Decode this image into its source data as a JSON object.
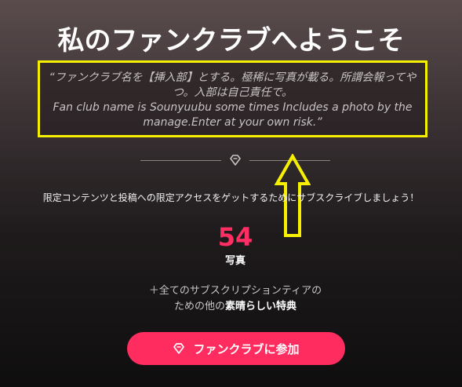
{
  "header": {
    "title": "私のファンクラブへようこそ"
  },
  "description": {
    "line1": "“ファンクラブ名を【挿入部】とする。極稀に写真が載る。所謂会報ってや",
    "line2": "つ。入部は自己責任で。",
    "line3": "Fan club name is Sounyuubu some times Includes a photo by the",
    "line4": "manage.Enter at your own risk.”"
  },
  "divider_icon": "diamond-icon",
  "subscribe_prompt": "限定コンテンツと投稿への限定アクセスをゲットするためにサブスクライブしましょう！",
  "stats": {
    "count": "54",
    "label": "写真"
  },
  "perks": {
    "line1": "＋全てのサブスクリプションティアの",
    "line2_prefix": "ための他の",
    "line2_strong": "素晴らしい特典"
  },
  "join_button": {
    "label": "ファンクラブに参加",
    "icon": "diamond-icon"
  },
  "colors": {
    "accent": "#ff2d5f",
    "highlight_box": "#f6f000",
    "count": "#ff2e63"
  }
}
